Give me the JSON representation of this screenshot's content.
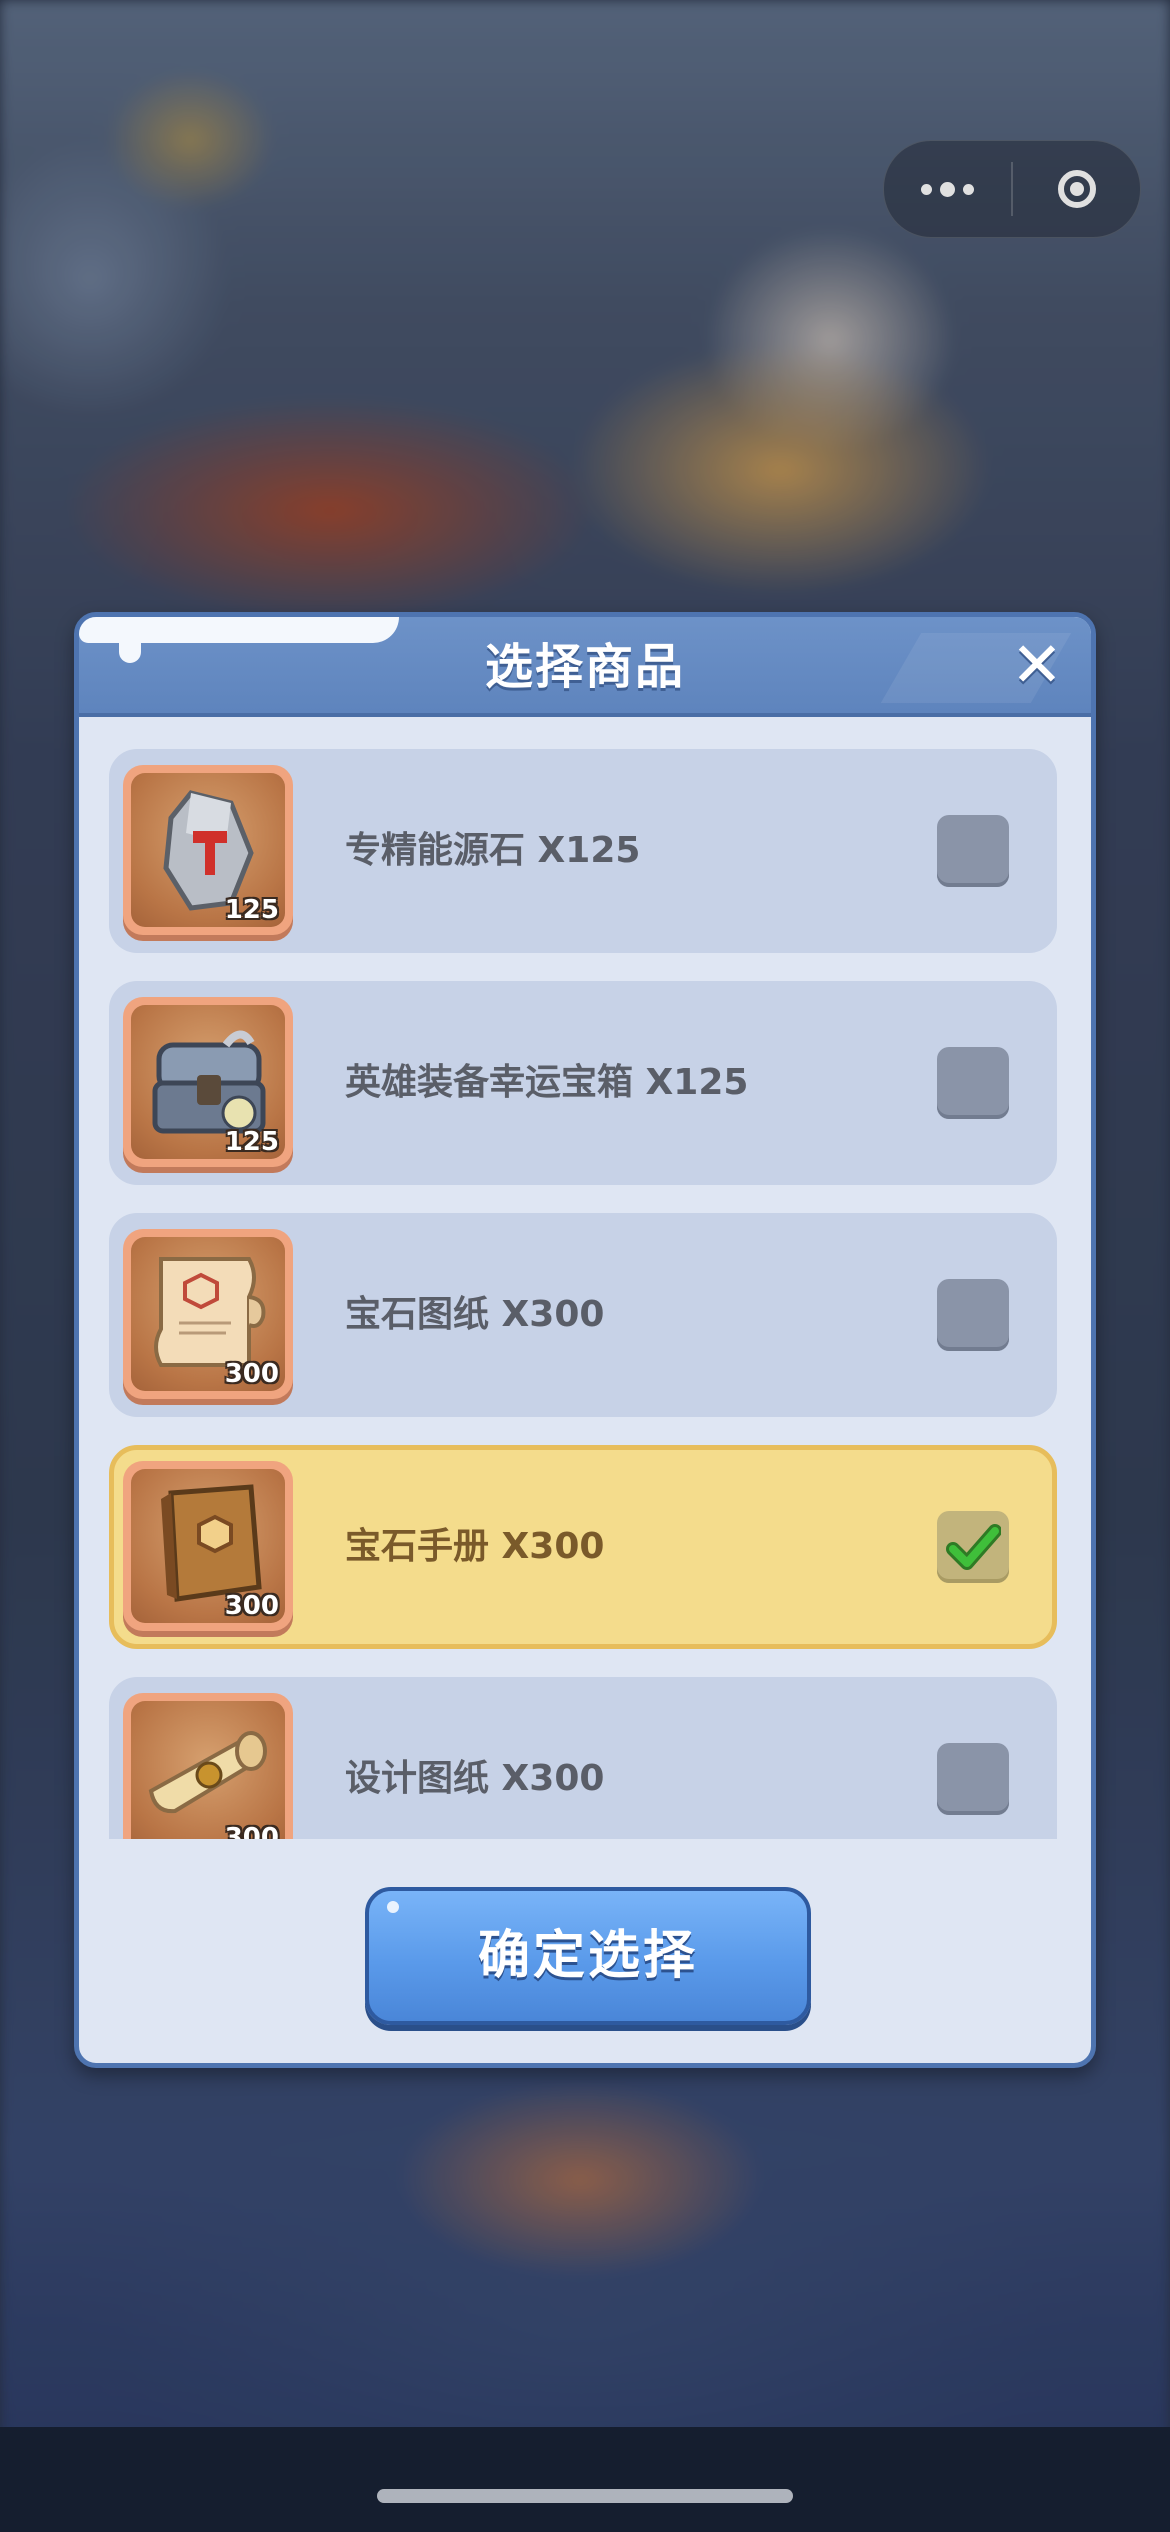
{
  "dialog": {
    "title": "选择商品",
    "close_icon": "close-icon",
    "confirm_label": "确定选择"
  },
  "items": [
    {
      "name": "专精能源石 X125",
      "qty": "125",
      "icon": "mastery-stone-icon",
      "checked": false
    },
    {
      "name": "英雄装备幸运宝箱 X125",
      "qty": "125",
      "icon": "treasure-chest-icon",
      "checked": false
    },
    {
      "name": "宝石图纸 X300",
      "qty": "300",
      "icon": "gem-scroll-icon",
      "checked": false
    },
    {
      "name": "宝石手册 X300",
      "qty": "300",
      "icon": "gem-manual-icon",
      "checked": true
    },
    {
      "name": "设计图纸 X300",
      "qty": "300",
      "icon": "design-scroll-icon",
      "checked": false
    }
  ],
  "capsule": {
    "more_icon": "more-dots-icon",
    "exit_icon": "exit-target-icon"
  },
  "colors": {
    "header": "#5e84bd",
    "selected_row": "#f4dc8c",
    "row": "#c7d2e7",
    "confirm_button": "#5a9aea",
    "check": "#3fbf3a"
  }
}
